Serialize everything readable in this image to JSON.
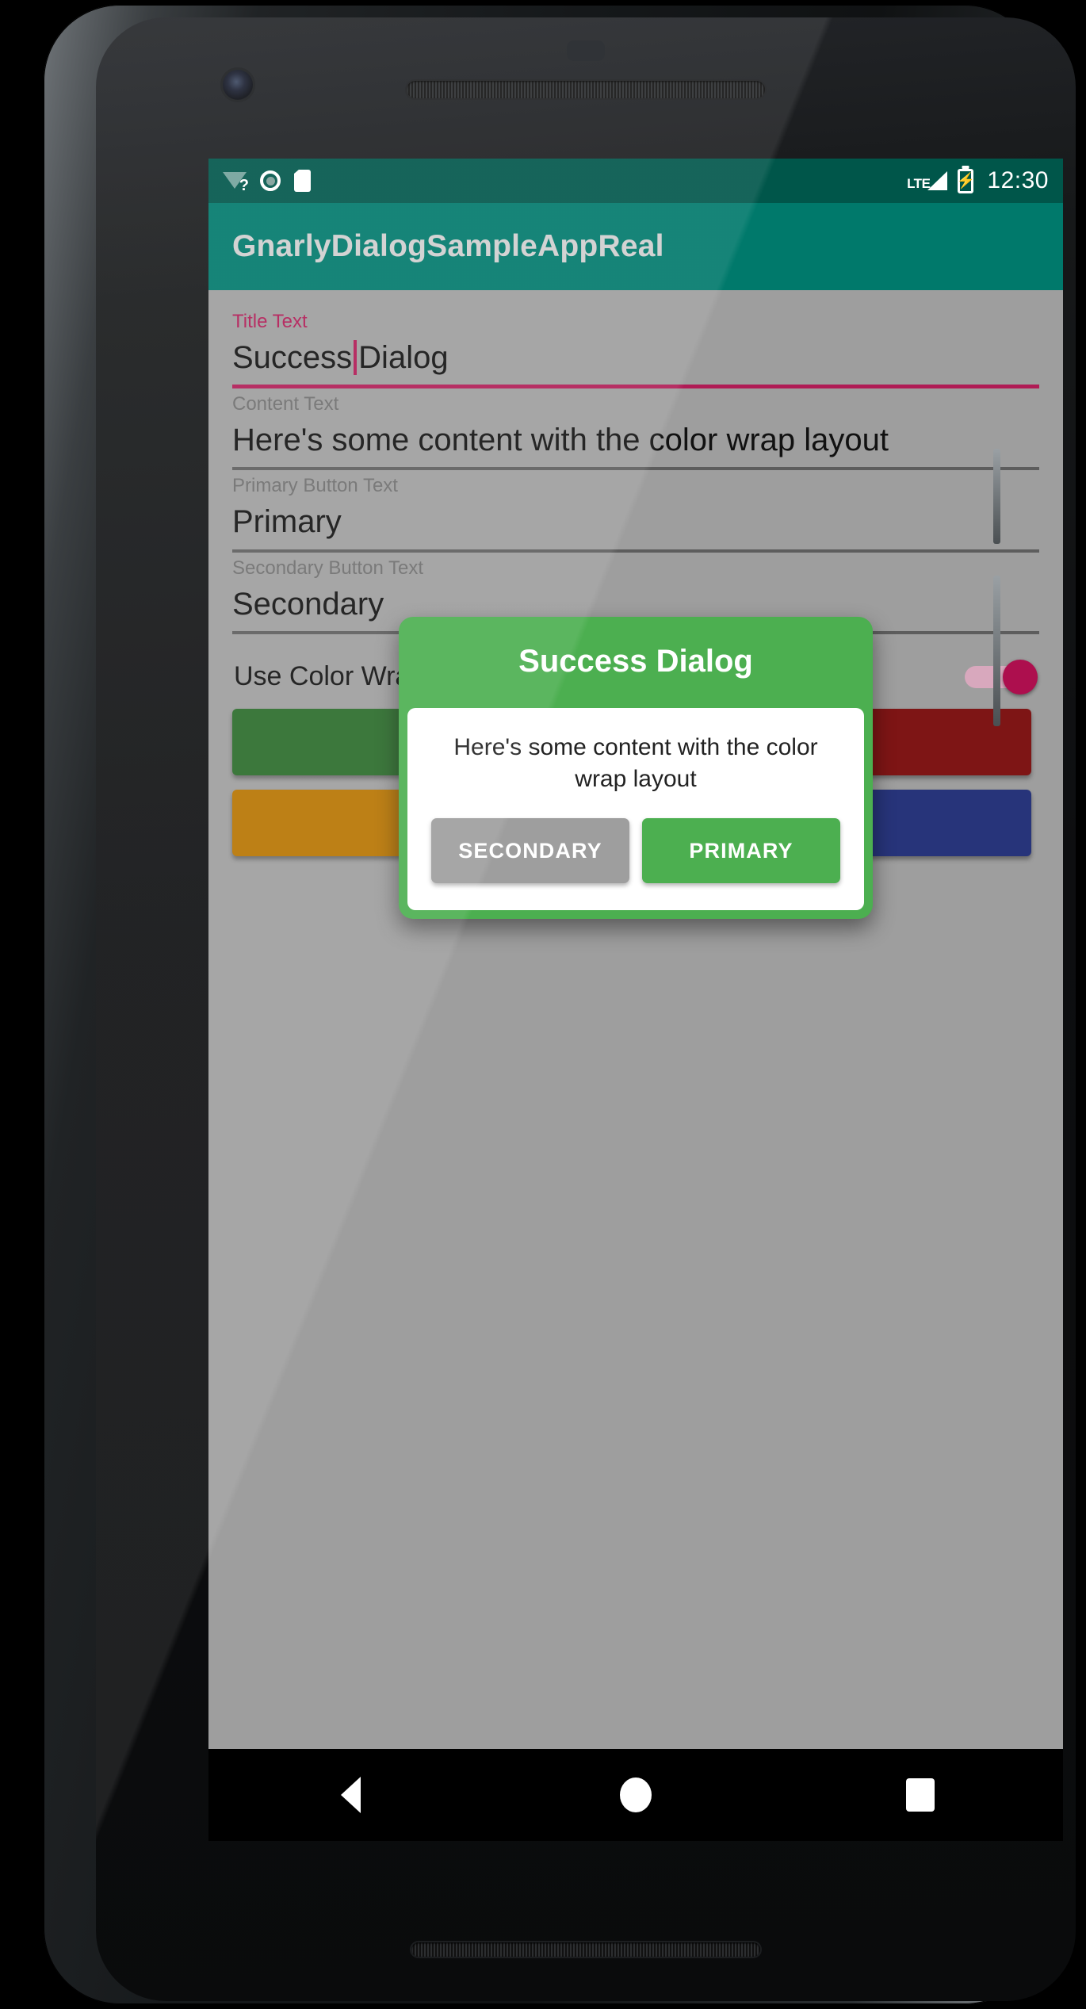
{
  "status_bar": {
    "icons_left": [
      "wifi-question-icon",
      "gps-icon",
      "sdcard-icon"
    ],
    "network_label": "LTE",
    "icons_right": [
      "signal-icon",
      "battery-charging-icon"
    ],
    "clock": "12:30"
  },
  "app_bar": {
    "title": "GnarlyDialogSampleAppReal"
  },
  "form": {
    "fields": [
      {
        "label": "Title Text",
        "value_before_caret": "Success",
        "value_after_caret": "Dialog",
        "accent": true
      },
      {
        "label": "Content Text",
        "value": "Here's some content with the color wrap layout",
        "accent": false
      },
      {
        "label": "Primary Button Text",
        "value": "Primary",
        "accent": false
      },
      {
        "label": "Secondary Button Text",
        "value": "Secondary",
        "accent": false
      }
    ],
    "switch": {
      "label": "Use Color Wrap Layout",
      "state": "on"
    },
    "color_buttons": [
      {
        "name": "green-color-button",
        "color": "#2A6B2A"
      },
      {
        "name": "red-color-button",
        "color": "#7E1515"
      },
      {
        "name": "orange-color-button",
        "color": "#B77400"
      },
      {
        "name": "blue-color-button",
        "color": "#27347A"
      }
    ]
  },
  "dialog": {
    "title": "Success Dialog",
    "content": "Here's some content with the color wrap layout",
    "secondary_button": "SECONDARY",
    "primary_button": "PRIMARY",
    "accent_color": "#4CAF50"
  },
  "nav_bar": {
    "items": [
      "back-icon",
      "home-icon",
      "recents-icon"
    ]
  },
  "colors": {
    "status_bar": "#00564A",
    "app_bar": "#00796B",
    "accent_pink": "#B01B55",
    "screen_background": "#9E9E9E",
    "dialog_green": "#4CAF50"
  }
}
